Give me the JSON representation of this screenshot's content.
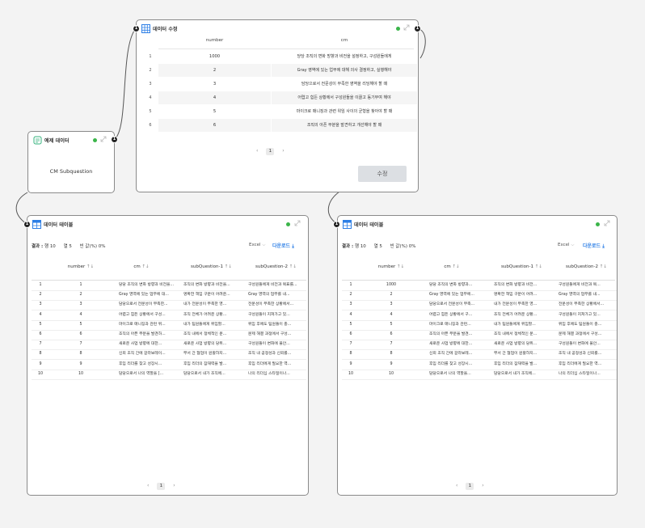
{
  "edit_node": {
    "title": "데이터 수정",
    "columns": [
      "number",
      "cm"
    ],
    "rows": [
      {
        "idx": "1",
        "number": "1000",
        "cm": "당당 조직의 변화 방향과 비전을 설정하고, 구성원들에게"
      },
      {
        "idx": "2",
        "number": "2",
        "cm": "Gray 영역에 있는 업무에 대해 의사 결정하고, 실행해야"
      },
      {
        "idx": "3",
        "number": "3",
        "cm": "담당으로서 전문성이 부족한 영역을 리딩해야 할 때"
      },
      {
        "idx": "4",
        "number": "4",
        "cm": "어렵고 힘든 상황에서 구성원들을 이끌고 동기부여 해야"
      },
      {
        "idx": "5",
        "number": "5",
        "cm": "마이크로 매니징과 관련 위임 사이의 균형을 찾아야 할 때"
      },
      {
        "idx": "6",
        "number": "6",
        "cm": "조직의 아픈 부분을 발견하고 개선해야 할 때"
      }
    ],
    "page": "1",
    "button_label": "수정"
  },
  "sample_node": {
    "title": "예제 데이터",
    "body": "CM Subquestion"
  },
  "table_left": {
    "title": "데이터 테이블",
    "summary": {
      "result_label": "결과 :",
      "rows_label": "행",
      "rows": "10",
      "cols_label": "열",
      "cols": "5",
      "null_label": "빈 값(%)",
      "null": "0%"
    },
    "excel_label": "Excel",
    "download_label": "다운로드",
    "columns": [
      "number",
      "cm",
      "subQuestion-1",
      "subQuestion-2"
    ],
    "rows": [
      {
        "idx": "1",
        "number": "1",
        "cm": "당당 조직의 변화 방향과 비전을...",
        "q1": "조직의 변화 방향과 비전을...",
        "q2": "구성원들에게 비전과 목표를..."
      },
      {
        "idx": "2",
        "number": "2",
        "cm": "Gray 영역에 있는 업무에 대...",
        "q1": "명확한 책임 구분이 어려운...",
        "q2": "Gray 영역의 업무를 내..."
      },
      {
        "idx": "3",
        "number": "3",
        "cm": "담당으로서 전문성이 부족한...",
        "q1": "내가 전문성이 부족한 영...",
        "q2": "전문성이 부족한 상황에서..."
      },
      {
        "idx": "4",
        "number": "4",
        "cm": "어렵고 힘든 상황에서 구성...",
        "q1": "조직 전체가 어려운 상황...",
        "q2": "구성원들이 지쳐가고 있..."
      },
      {
        "idx": "5",
        "number": "5",
        "cm": "마이크로 매니징과 관련 위...",
        "q1": "내가 팀원들에게 위임할...",
        "q2": "위임 후에도 팀원들이 충..."
      },
      {
        "idx": "6",
        "number": "6",
        "cm": "조직의 아픈 부분을 발견하...",
        "q1": "조직 내에서 정체적인 문...",
        "q2": "문제 해결 과정에서 구성..."
      },
      {
        "idx": "7",
        "number": "7",
        "cm": "새로운 사업 방향에 대한...",
        "q1": "새로운 사업 방향의 당위...",
        "q2": "구성원들이 변화에 불안..."
      },
      {
        "idx": "8",
        "number": "8",
        "cm": "신뢰 조직 간에 갈라보레이...",
        "q1": "부서 간 협업이 원활하지...",
        "q2": "조직 내 공정성과 신뢰를..."
      },
      {
        "idx": "9",
        "number": "9",
        "cm": "후임 리더를 찾고 성장시...",
        "q1": "후임 리더의 잠재력을 발...",
        "q2": "후임 리더에게 필요한 역..."
      },
      {
        "idx": "10",
        "number": "10",
        "cm": "담당으로서 나의 역할을 [...",
        "q1": "담당으로서 내가 조직에...",
        "q2": "나의 리더십 스타일이나..."
      }
    ],
    "page": "1"
  },
  "table_right": {
    "title": "데이터 테이블",
    "summary": {
      "result_label": "결과 :",
      "rows_label": "행",
      "rows": "10",
      "cols_label": "열",
      "cols": "5",
      "null_label": "빈 값(%)",
      "null": "0%"
    },
    "excel_label": "Excel",
    "download_label": "다운로드",
    "columns": [
      "number",
      "cm",
      "subQuestion-1",
      "subQuestion-2"
    ],
    "rows": [
      {
        "idx": "1",
        "number": "1000",
        "cm": "당당 조직의 변화 방향과...",
        "q1": "조직의 변화 방향과 비전...",
        "q2": "구성원들에게 비전과 목..."
      },
      {
        "idx": "2",
        "number": "2",
        "cm": "Gray 영역에 있는 업무에...",
        "q1": "명확한 책임 구분이 어려...",
        "q2": "Gray 영역의 업무를 내..."
      },
      {
        "idx": "3",
        "number": "3",
        "cm": "담당으로서 전문성이 부족...",
        "q1": "내가 전문성이 부족한 영...",
        "q2": "전문성이 부족한 상황에서..."
      },
      {
        "idx": "4",
        "number": "4",
        "cm": "어렵고 힘든 상황에서 구...",
        "q1": "조직 전체가 어려운 상황...",
        "q2": "구성원들이 지쳐가고 있..."
      },
      {
        "idx": "5",
        "number": "5",
        "cm": "마이크로 매니징과 관련...",
        "q1": "내가 팀원들에게 위임할...",
        "q2": "위임 후에도 팀원들이 충..."
      },
      {
        "idx": "6",
        "number": "6",
        "cm": "조직의 아픈 부분을 발견...",
        "q1": "조직 내에서 정체적인 문...",
        "q2": "문제 해결 과정에서 구성..."
      },
      {
        "idx": "7",
        "number": "7",
        "cm": "새로운 사업 방향에 대한...",
        "q1": "새로운 사업 방향의 당위...",
        "q2": "구성원들이 변화에 불안..."
      },
      {
        "idx": "8",
        "number": "8",
        "cm": "신뢰 조직 간에 갈라보레...",
        "q1": "부서 간 협업이 원활하지...",
        "q2": "조직 내 공정성과 신뢰를..."
      },
      {
        "idx": "9",
        "number": "9",
        "cm": "후임 리더를 찾고 성장시...",
        "q1": "후임 리더의 잠재력을 발...",
        "q2": "후임 리더에게 필요한 역..."
      },
      {
        "idx": "10",
        "number": "10",
        "cm": "담당으로서 나의 역할을...",
        "q1": "담당으로서 내가 조직에...",
        "q2": "나의 리더십 스타일이나..."
      }
    ],
    "page": "1"
  },
  "ports": {
    "label": "1"
  },
  "icons": {
    "table": "table-icon",
    "grid": "grid-icon",
    "sample": "database-icon",
    "expand": "expand-icon",
    "sort": "sort-icon",
    "chevron": "chevron-down-icon",
    "download": "download-icon"
  },
  "colors": {
    "accent": "#2d7fe6",
    "status": "#3bb54a",
    "sample_icon": "#36b37e"
  }
}
